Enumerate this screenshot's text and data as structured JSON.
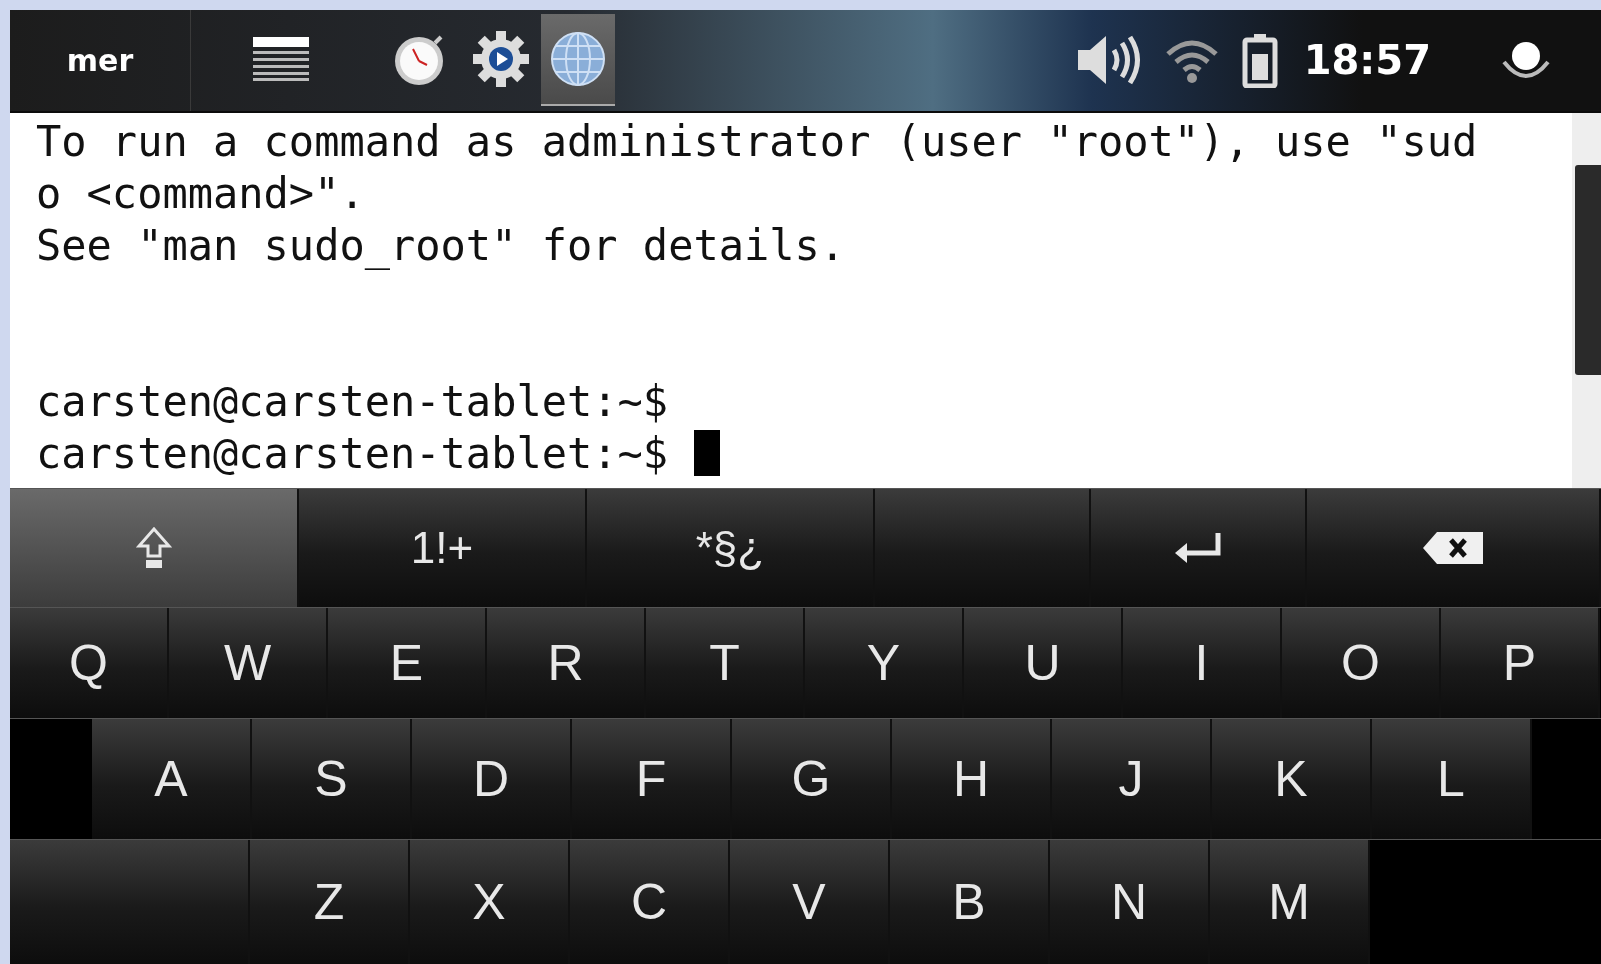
{
  "panel": {
    "logo": "mer",
    "launchers": [
      {
        "kind": "menu",
        "selected": false
      },
      {
        "kind": "clock",
        "selected": false
      },
      {
        "kind": "settings",
        "selected": false
      },
      {
        "kind": "globe",
        "selected": true
      }
    ],
    "time": "18:57"
  },
  "terminal": {
    "output": [
      "To run a command as administrator (user \"root\"), use \"sud",
      "o <command>\".",
      "See \"man sudo_root\" for details."
    ],
    "prompts": [
      "carsten@carsten-tablet:~$",
      "carsten@carsten-tablet:~$"
    ]
  },
  "keyboard": {
    "shift": {
      "on": true
    },
    "function_keys": [
      {
        "kind": "label",
        "label": "1!+"
      },
      {
        "kind": "label",
        "label": "*§¿"
      },
      {
        "kind": "space"
      },
      {
        "kind": "enter"
      },
      {
        "kind": "backspace"
      }
    ],
    "rows": [
      [
        "Q",
        "W",
        "E",
        "R",
        "T",
        "Y",
        "U",
        "I",
        "O",
        "P"
      ],
      [
        "A",
        "S",
        "D",
        "F",
        "G",
        "H",
        "J",
        "K",
        "L"
      ],
      [
        "Z",
        "X",
        "C",
        "V",
        "B",
        "N",
        "M"
      ]
    ]
  }
}
